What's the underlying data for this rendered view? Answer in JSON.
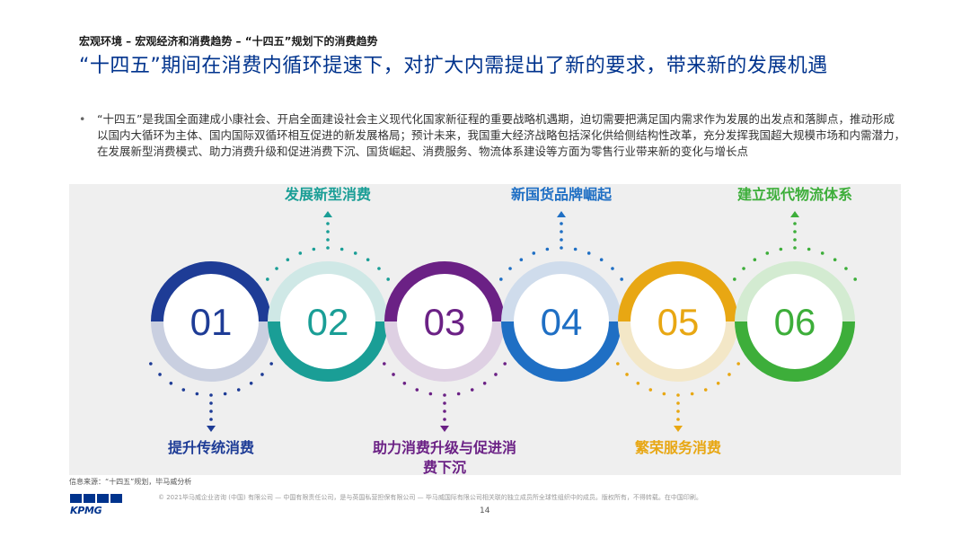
{
  "header": {
    "breadcrumb": "宏观环境 – 宏观经济和消费趋势 – “十四五”规划下的消费趋势",
    "title": "“十四五”期间在消费内循环提速下，对扩大内需提出了新的要求，带来新的发展机遇"
  },
  "bullet": {
    "marker": "•",
    "text": "“十四五”是我国全面建成小康社会、开启全面建设社会主义现代化国家新征程的重要战略机遇期，迫切需要把满足国内需求作为发展的出发点和落脚点，推动形成以国内大循环为主体、国内国际双循环相互促进的新发展格局；预计未来，我国重大经济战略包括深化供给侧结构性改革，充分发挥我国超大规模市场和内需潜力，在发展新型消费模式、助力消费升级和促进消费下沉、国货崛起、消费服务、物流体系建设等方面为零售行业带来新的变化与增长点"
  },
  "steps": [
    {
      "num": "01",
      "label": "提升传统消费",
      "label_position": "bottom",
      "color": "#1E3C96",
      "light": "#C9CFE0"
    },
    {
      "num": "02",
      "label": "发展新型消费",
      "label_position": "top",
      "color": "#1A9E96",
      "light": "#CFE8E6"
    },
    {
      "num": "03",
      "label": "助力消费升级与促进消费下沉",
      "label_position": "bottom",
      "color": "#6B2185",
      "light": "#DED0E3"
    },
    {
      "num": "04",
      "label": "新国货品牌崛起",
      "label_position": "top",
      "color": "#1F6FC4",
      "light": "#CFDCEC"
    },
    {
      "num": "05",
      "label": "繁荣服务消费",
      "label_position": "bottom",
      "color": "#E8A713",
      "light": "#F3E7C7"
    },
    {
      "num": "06",
      "label": "建立现代物流体系",
      "label_position": "top",
      "color": "#3DAE3A",
      "light": "#D3EBD1"
    }
  ],
  "footer": {
    "source": "信息来源：“十四五”规划，毕马威分析",
    "logo_text": "KPMG",
    "legal": "© 2021毕马威企业咨询 (中国) 有限公司 — 中国有限责任公司，是与英国私营担保有限公司 — 毕马威国际有限公司相关联的独立成员所全球性组织中的成员。版权所有，不得转载。在中国印刷。",
    "page_number": "14"
  }
}
